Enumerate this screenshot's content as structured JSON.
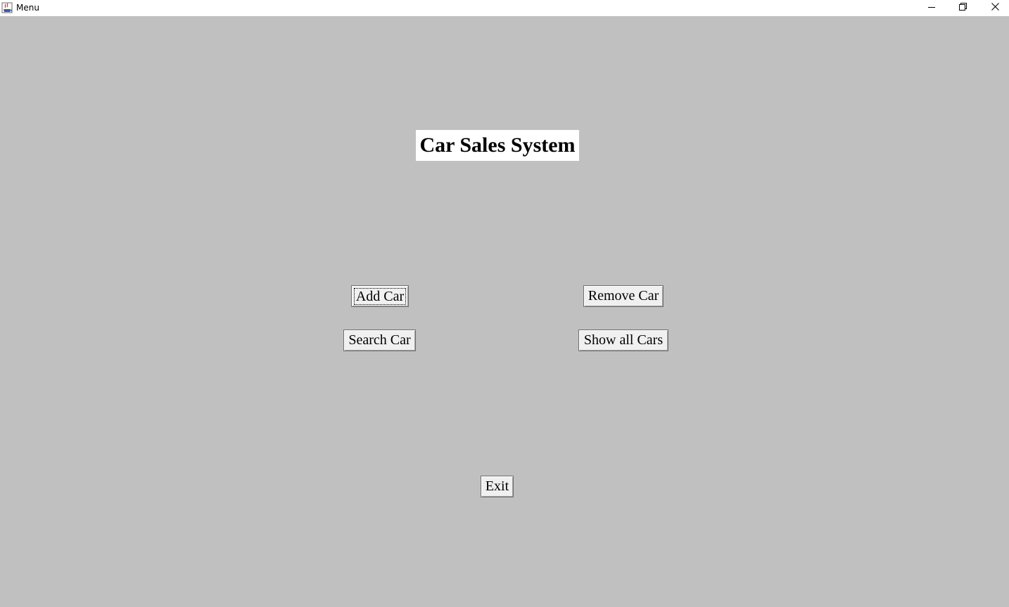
{
  "window": {
    "title": "Menu",
    "icon": "java-app-icon",
    "controls": {
      "minimize_icon": "minimize-icon",
      "maximize_icon": "restore-icon",
      "close_icon": "close-icon"
    }
  },
  "main": {
    "heading": "Car Sales System",
    "buttons": {
      "add_car": "Add Car",
      "remove_car": "Remove Car",
      "search_car": "Search Car",
      "show_all_cars": "Show all Cars",
      "exit": "Exit"
    }
  },
  "colors": {
    "background": "#c0c0c0",
    "heading_background": "#ffffff",
    "button_face": "#f0f0f0"
  }
}
